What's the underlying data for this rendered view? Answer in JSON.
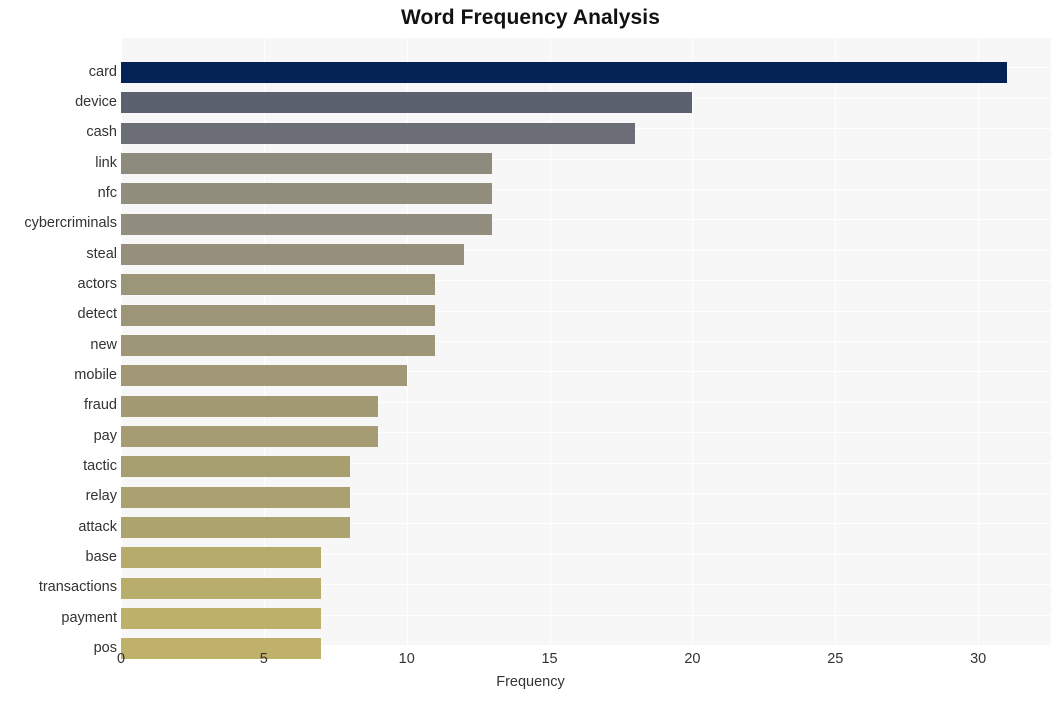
{
  "chart_data": {
    "type": "bar",
    "orientation": "horizontal",
    "title": "Word Frequency Analysis",
    "xlabel": "Frequency",
    "ylabel": "",
    "categories": [
      "card",
      "device",
      "cash",
      "link",
      "nfc",
      "cybercriminals",
      "steal",
      "actors",
      "detect",
      "new",
      "mobile",
      "fraud",
      "pay",
      "tactic",
      "relay",
      "attack",
      "base",
      "transactions",
      "payment",
      "pos"
    ],
    "values": [
      31,
      20,
      18,
      13,
      13,
      13,
      12,
      11,
      11,
      11,
      10,
      9,
      9,
      8,
      8,
      8,
      7,
      7,
      7,
      7
    ],
    "bar_colors": [
      "#042253",
      "#5c6170",
      "#6b6d77",
      "#8d8b7d",
      "#918e7d",
      "#918d7f",
      "#968f7c",
      "#9b9579",
      "#9c9578",
      "#9d9677",
      "#a09876",
      "#a39a74",
      "#a59c73",
      "#a89f71",
      "#aba170",
      "#ada36e",
      "#b5ab6c",
      "#b9ad6b",
      "#bcb06a",
      "#bfb169"
    ],
    "xticks": [
      0,
      5,
      10,
      15,
      20,
      25,
      30
    ],
    "xlim": [
      0,
      32.55
    ],
    "ylim_categories": 20,
    "grid": true,
    "grid_color": "#ffffff",
    "plot_background": "#f7f7f7",
    "figure_background": "#ffffff",
    "legend": null
  }
}
